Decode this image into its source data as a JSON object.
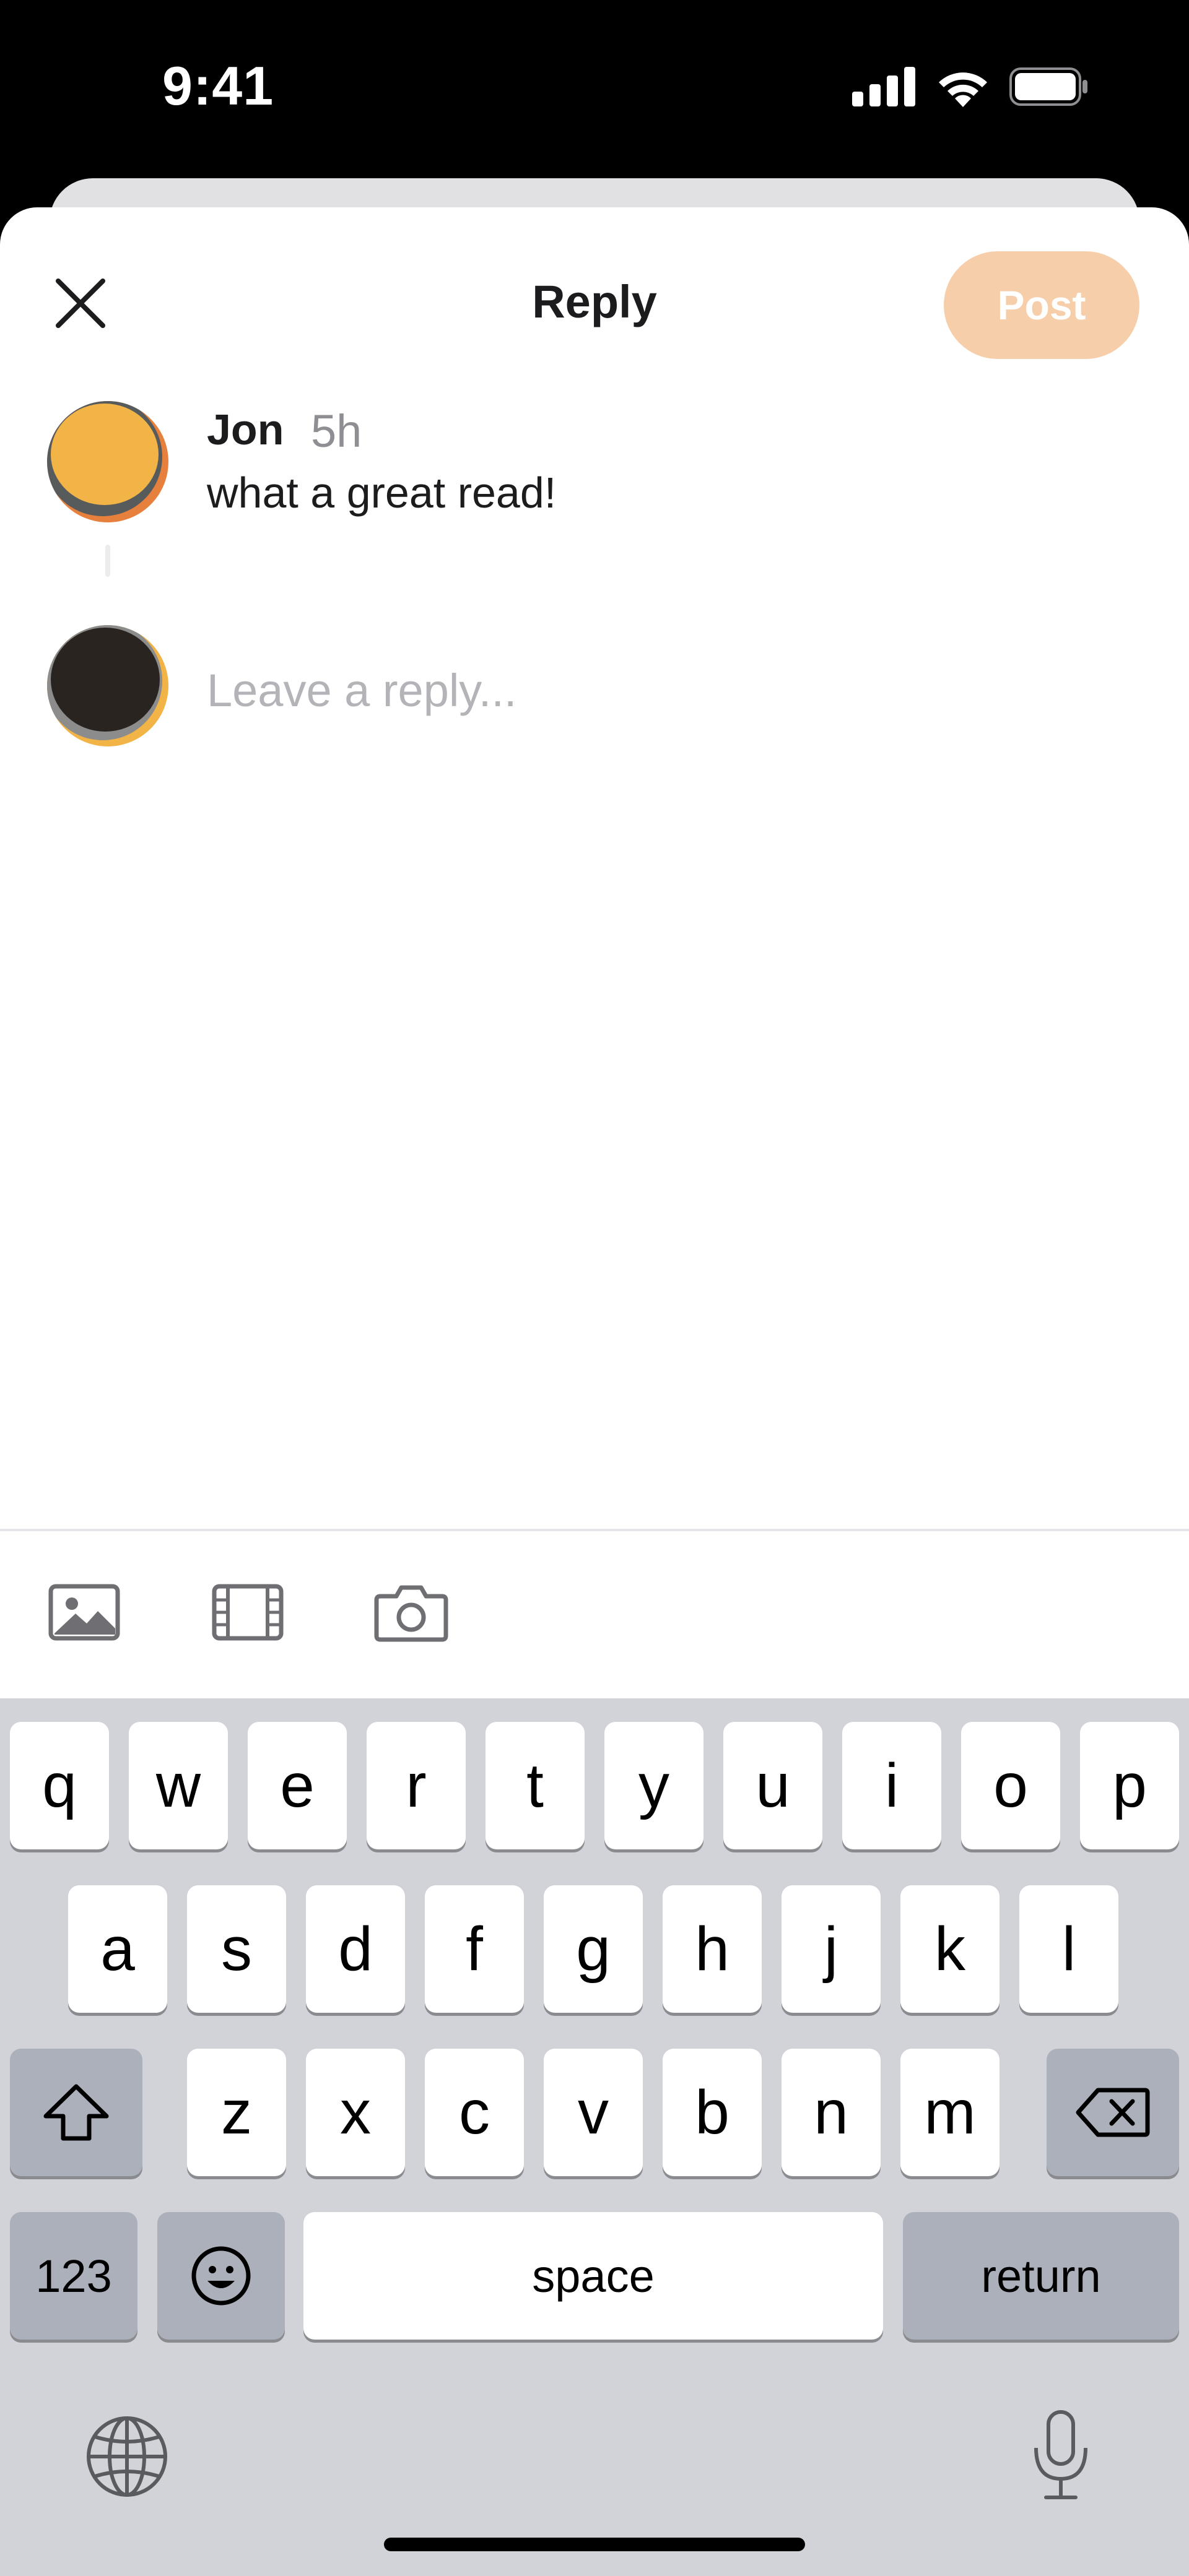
{
  "status_bar": {
    "time": "9:41"
  },
  "header": {
    "title": "Reply",
    "post_label": "Post",
    "close_icon": "close-icon"
  },
  "comment": {
    "author": "Jon",
    "time": "5h",
    "text": "what a great read!"
  },
  "reply": {
    "placeholder": "Leave a reply...",
    "value": ""
  },
  "attachments": [
    {
      "name": "image-icon"
    },
    {
      "name": "video-icon"
    },
    {
      "name": "camera-icon"
    }
  ],
  "keyboard": {
    "row1": [
      "q",
      "w",
      "e",
      "r",
      "t",
      "y",
      "u",
      "i",
      "o",
      "p"
    ],
    "row2": [
      "a",
      "s",
      "d",
      "f",
      "g",
      "h",
      "j",
      "k",
      "l"
    ],
    "row3": [
      "z",
      "x",
      "c",
      "v",
      "b",
      "n",
      "m"
    ],
    "numbers_label": "123",
    "space_label": "space",
    "return_label": "return"
  },
  "colors": {
    "post_button_bg": "#f7ceaa",
    "keyboard_bg": "#d1d3d9",
    "placeholder": "#b4b4b8"
  }
}
